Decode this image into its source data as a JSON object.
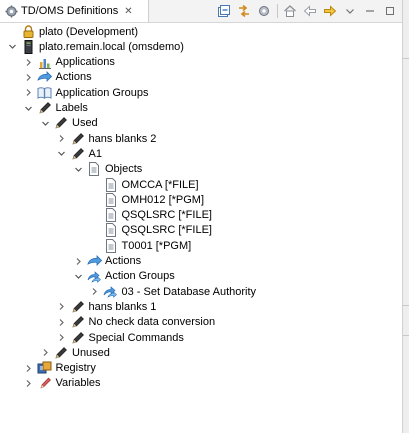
{
  "view": {
    "tab_title": "TD/OMS Definitions",
    "tab_close": "✕",
    "tab_icon": "gear-icon",
    "toolbar": [
      "collapse-all-icon",
      "link-with-editor-icon",
      "settings-icon",
      "home-icon",
      "back-icon",
      "forward-icon",
      "view-menu-icon",
      "minimize-icon",
      "maximize-icon"
    ]
  },
  "tree": {
    "items": [
      {
        "label": "plato (Development)",
        "icon": "lock-icon",
        "twisty": ""
      },
      {
        "label": "plato.remain.local (omsdemo)",
        "icon": "server-icon",
        "twisty": "expanded"
      },
      {
        "label": "Applications",
        "icon": "chart-icon",
        "twisty": "collapsed"
      },
      {
        "label": "Actions",
        "icon": "arrow-icon",
        "twisty": "collapsed"
      },
      {
        "label": "Application Groups",
        "icon": "book-icon",
        "twisty": "collapsed"
      },
      {
        "label": "Labels",
        "icon": "pen-icon",
        "twisty": "expanded"
      },
      {
        "label": "Used",
        "icon": "pen-icon",
        "twisty": "expanded"
      },
      {
        "label": "hans blanks 2",
        "icon": "pen-icon",
        "twisty": "collapsed"
      },
      {
        "label": "A1",
        "icon": "pen-icon",
        "twisty": "expanded"
      },
      {
        "label": "Objects",
        "icon": "document-icon",
        "twisty": "expanded"
      },
      {
        "label": "OMCCA [*FILE]",
        "icon": "document-icon",
        "twisty": ""
      },
      {
        "label": "OMH012 [*PGM]",
        "icon": "document-icon",
        "twisty": ""
      },
      {
        "label": "QSQLSRC [*FILE]",
        "icon": "document-icon",
        "twisty": ""
      },
      {
        "label": "QSQLSRC [*FILE]",
        "icon": "document-icon",
        "twisty": ""
      },
      {
        "label": "T0001 [*PGM]",
        "icon": "document-icon",
        "twisty": ""
      },
      {
        "label": "Actions",
        "icon": "arrow-icon",
        "twisty": "collapsed"
      },
      {
        "label": "Action Groups",
        "icon": "action-group-icon",
        "twisty": "expanded"
      },
      {
        "label": "03 - Set Database Authority",
        "icon": "action-group-icon",
        "twisty": "collapsed"
      },
      {
        "label": "hans blanks 1",
        "icon": "pen-icon",
        "twisty": "collapsed"
      },
      {
        "label": "No check data conversion",
        "icon": "pen-icon",
        "twisty": "collapsed"
      },
      {
        "label": "Special Commands",
        "icon": "pen-icon",
        "twisty": "collapsed"
      },
      {
        "label": "Unused",
        "icon": "pen-icon",
        "twisty": "collapsed"
      },
      {
        "label": "Registry",
        "icon": "registry-icon",
        "twisty": "collapsed"
      },
      {
        "label": "Variables",
        "icon": "variable-icon",
        "twisty": "collapsed"
      }
    ]
  }
}
